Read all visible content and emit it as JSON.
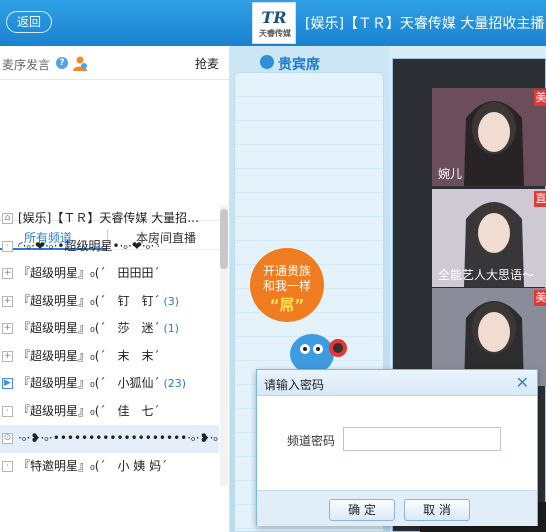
{
  "header": {
    "back_label": "返回",
    "logo_text": "TR",
    "logo_subtext": "天睿传媒",
    "room_title": "[娱乐]【ＴＲ】天睿传媒 大量招收主播"
  },
  "mic": {
    "label": "麦序发言",
    "help_icon": "?",
    "grab_label": "抢麦"
  },
  "tabs": {
    "all": "所有频道",
    "live": "本房间直播"
  },
  "channels": [
    {
      "icon": "home",
      "name": "[娱乐]【ＴＲ】天睿传媒 大量招…",
      "count": ""
    },
    {
      "icon": "box",
      "name": "◜·৹·❤·৹·•超级明星•·৹·❤·৹·◝",
      "count": ""
    },
    {
      "icon": "plus",
      "name": "『超级明星』₀(ˊ　田田田ˊ",
      "count": ""
    },
    {
      "icon": "plus",
      "name": "『超级明星』₀(ˊ　钉　钉ˊ",
      "count": "(3)"
    },
    {
      "icon": "plus",
      "name": "『超级明星』₀(ˊ　莎　迷ˊ",
      "count": "(1)"
    },
    {
      "icon": "plus",
      "name": "『超级明星』₀(ˊ　末　末ˊ",
      "count": ""
    },
    {
      "icon": "play",
      "name": "『超级明星』₀(ˊ　小狐仙ˊ",
      "count": "(23)"
    },
    {
      "icon": "box",
      "name": "『超级明星』₀(ˊ　佳　七ˊ",
      "count": ""
    },
    {
      "icon": "lock",
      "name": "·৹·❥·৹·•••••••••••••••••••·৹·❥·৹·",
      "count": ""
    },
    {
      "icon": "box",
      "name": "『特邀明星』₀(ˊ　小 姨 妈ˊ",
      "count": ""
    }
  ],
  "vip": {
    "title": "贵宾席",
    "promo_line1": "开通贵族",
    "promo_line2": "和我一样",
    "promo_line3": "“屌”"
  },
  "videos": [
    {
      "name": "婉儿",
      "tag": "美",
      "bg": "#6b4e5a"
    },
    {
      "name": "全能艺人大思语～",
      "tag": "直",
      "bg": "#cfc9d3"
    },
    {
      "name": "",
      "tag": "美",
      "bg": "#8a8d99"
    }
  ],
  "dialog": {
    "title": "请输入密码",
    "close_icon": "✕",
    "field_label": "频道密码",
    "field_value": "",
    "ok_label": "确 定",
    "cancel_label": "取 消"
  },
  "colors": {
    "header_blue": "#1a82cf",
    "accent_blue": "#2b7bd3",
    "promo_orange": "#f07c22",
    "tag_red": "#e23a3a"
  }
}
